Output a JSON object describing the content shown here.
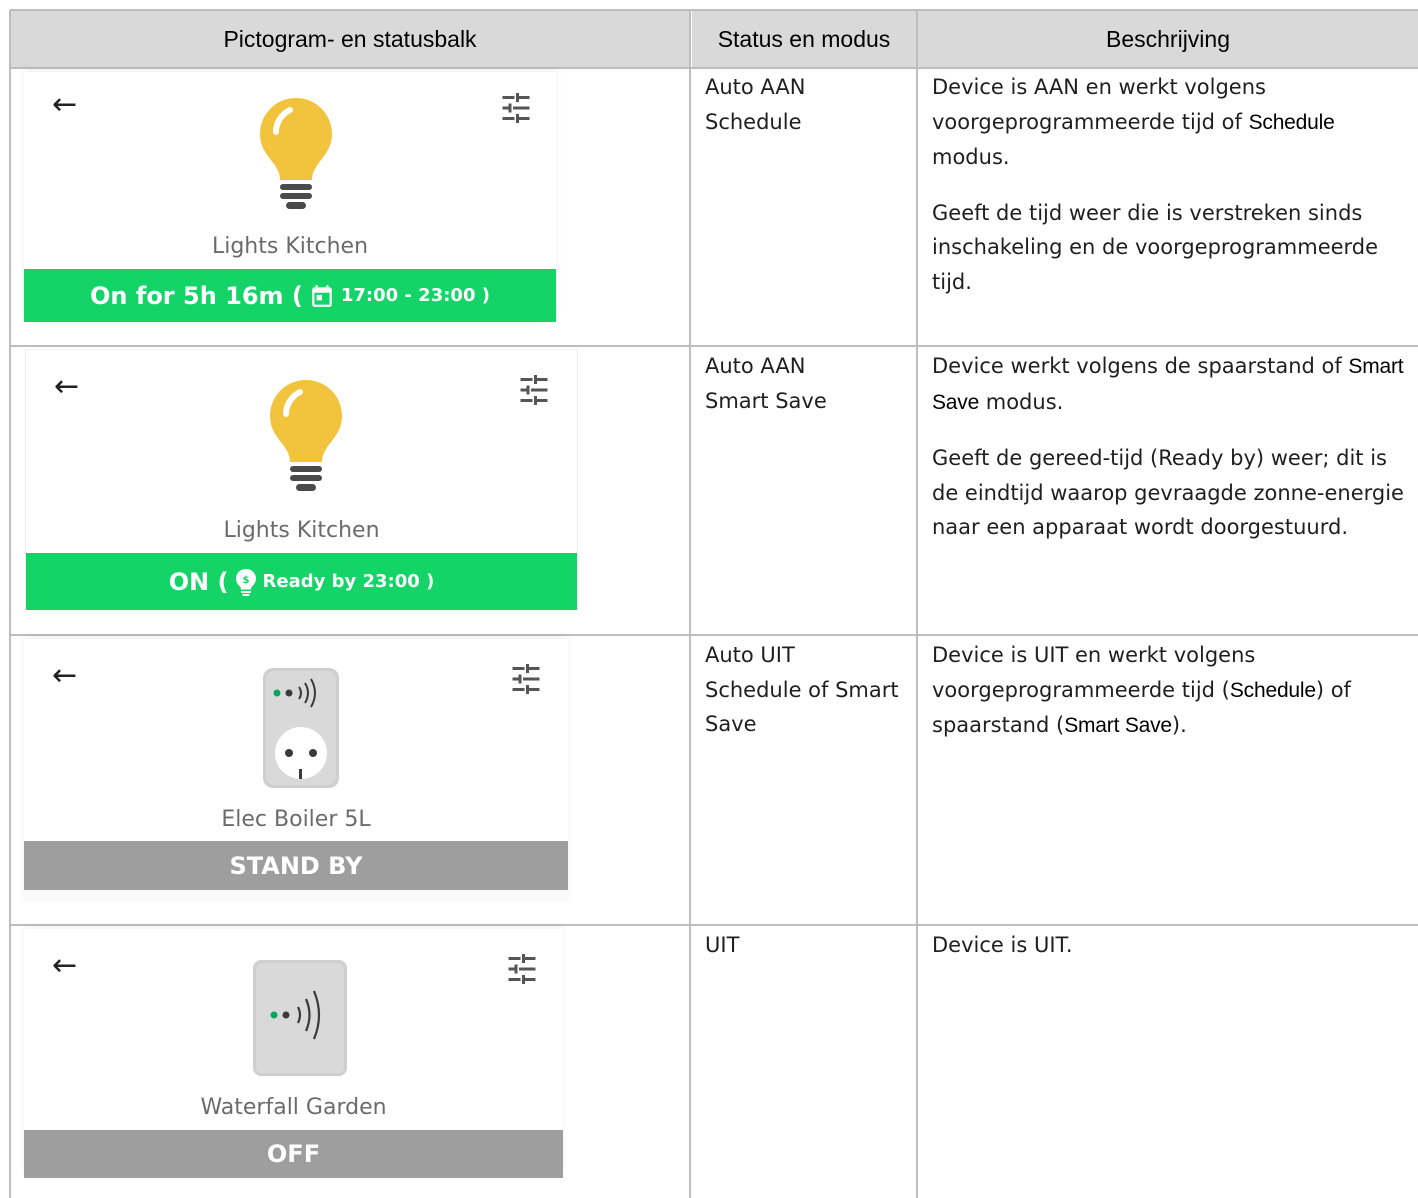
{
  "header": {
    "col1": "Pictogram- en statusbalk",
    "col2": "Status en modus",
    "col3": "Beschrijving"
  },
  "rows": [
    {
      "device_name": "Lights Kitchen",
      "bar_main": "On for 5h 16m (",
      "bar_icon": "calendar-icon",
      "bar_small": "17:00 - 23:00 )",
      "bar_color": "#14d468",
      "status_line1": "Auto AAN",
      "status_line2": "Schedule",
      "desc_p1_a": "Device is AAN en werkt volgens voorgeprogrammeerde tijd of ",
      "desc_p1_b": "Schedule",
      "desc_p1_c": " modus.",
      "desc_p2": "Geeft de tijd weer die is verstreken sinds inschakeling en de voorgeprogrammeerde tijd."
    },
    {
      "device_name": "Lights Kitchen",
      "bar_main": "ON (",
      "bar_icon": "smart-save-bulb-icon",
      "bar_small": "Ready by 23:00 )",
      "bar_color": "#14d468",
      "status_line1": "Auto AAN",
      "status_line2": "Smart Save",
      "desc_p1_a": "Device werkt volgens de spaarstand of ",
      "desc_p1_b": "Smart Save",
      "desc_p1_c": " modus.",
      "desc_p2": "Geeft de gereed-tijd (Ready by) weer; dit is de eindtijd waarop gevraagde zonne-energie naar een apparaat wordt doorgestuurd."
    },
    {
      "device_name": "Elec Boiler 5L",
      "bar_main": "STAND BY",
      "bar_color": "#9e9e9e",
      "status_line1": "Auto UIT",
      "status_line2": "Schedule of Smart Save",
      "desc_a": "Device is UIT en werkt volgens voorgeprogrammeerde tijd (",
      "desc_b": "Schedule",
      "desc_c": ") of spaarstand (",
      "desc_d": "Smart Save",
      "desc_e": ")."
    },
    {
      "device_name": "Waterfall Garden",
      "bar_main": "OFF",
      "bar_color": "#9e9e9e",
      "status_line1": "UIT",
      "desc": "Device is UIT."
    }
  ],
  "colors": {
    "bulb": "#f2c43d",
    "on_bar": "#14d468",
    "off_bar": "#9e9e9e",
    "header_bg": "#d9d9d9"
  }
}
